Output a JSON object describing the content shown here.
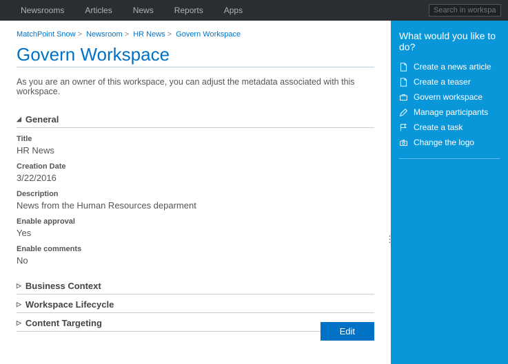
{
  "topnav": {
    "items": [
      "Newsrooms",
      "Articles",
      "News",
      "Reports",
      "Apps"
    ],
    "search_placeholder": "Search in workspace"
  },
  "breadcrumb": {
    "parts": [
      "MatchPoint Snow",
      "Newsroom",
      "HR News",
      "Govern Workspace"
    ]
  },
  "page": {
    "title": "Govern Workspace",
    "intro": "As you are an owner of this workspace, you can adjust the metadata associated with this workspace."
  },
  "sections": {
    "general": {
      "label": "General",
      "fields": {
        "title_label": "Title",
        "title_value": "HR News",
        "creation_label": "Creation Date",
        "creation_value": "3/22/2016",
        "desc_label": "Description",
        "desc_value": "News from the Human Resources deparment",
        "approval_label": "Enable approval",
        "approval_value": "Yes",
        "comments_label": "Enable comments",
        "comments_value": "No"
      }
    },
    "business": {
      "label": "Business Context"
    },
    "lifecycle": {
      "label": "Workspace Lifecycle"
    },
    "targeting": {
      "label": "Content Targeting"
    }
  },
  "buttons": {
    "edit": "Edit"
  },
  "sidebar": {
    "title": "What would you like to do?",
    "actions": [
      "Create a news article",
      "Create a teaser",
      "Govern workspace",
      "Manage participants",
      "Create a task",
      "Change the logo"
    ]
  }
}
